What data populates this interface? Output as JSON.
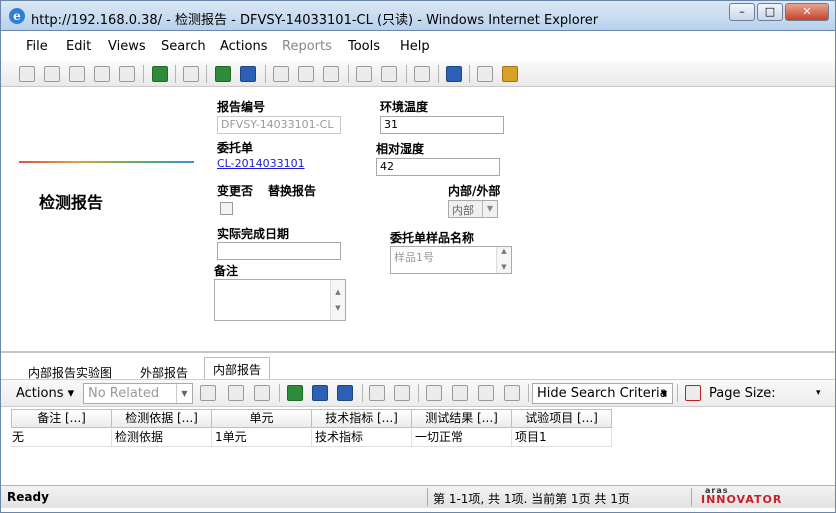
{
  "window": {
    "title": "http://192.168.0.38/ - 检测报告 - DFVSY-14033101-CL (只读) - Windows Internet Explorer",
    "minimize": "–",
    "maximize": "□",
    "close": "✕"
  },
  "menu": [
    "File",
    "Edit",
    "Views",
    "Search",
    "Actions",
    "Reports",
    "Tools",
    "Help"
  ],
  "form": {
    "heading": "检测报告",
    "report_no_label": "报告编号",
    "report_no_value": "DFVSY-14033101-CL",
    "env_temp_label": "环境温度",
    "env_temp_value": "31",
    "commission_label": "委托单",
    "commission_value": "CL-2014033101",
    "humidity_label": "相对湿度",
    "humidity_value": "42",
    "change_label": "变更否",
    "replace_label": "替换报告",
    "internal_external_label": "内部/外部",
    "internal_external_value": "内部",
    "actual_date_label": "实际完成日期",
    "actual_date_value": "",
    "sample_name_label": "委托单样品名称",
    "sample_name_value": "样品1号",
    "remark_label": "备注",
    "remark_value": ""
  },
  "relationship": {
    "tabs": [
      "内部报告实验图",
      "外部报告",
      "内部报告"
    ],
    "active_tab": 2,
    "actions_label": "Actions ▾",
    "related_select": "No Related",
    "hide_search": "Hide Search Criteria",
    "page_size_label": "Page Size:",
    "columns": [
      "备注 [...]",
      "检测依据 [...]",
      "单元",
      "技术指标 [...]",
      "测试结果 [...]",
      "试验项目 [...]"
    ],
    "rows": [
      [
        "无",
        "检测依据",
        "1单元",
        "技术指标",
        "一切正常",
        "项目1"
      ]
    ]
  },
  "status": {
    "ready": "Ready",
    "page_info": "第 1-1项, 共 1项. 当前第 1页 共 1页",
    "logo_top": "aras",
    "logo_bottom": "INNOVATOR"
  },
  "colors": {
    "link": "#1a1ad6",
    "titlebar": "#c6daf0",
    "close_button": "#c7422a",
    "logo_red": "#c8202a"
  }
}
